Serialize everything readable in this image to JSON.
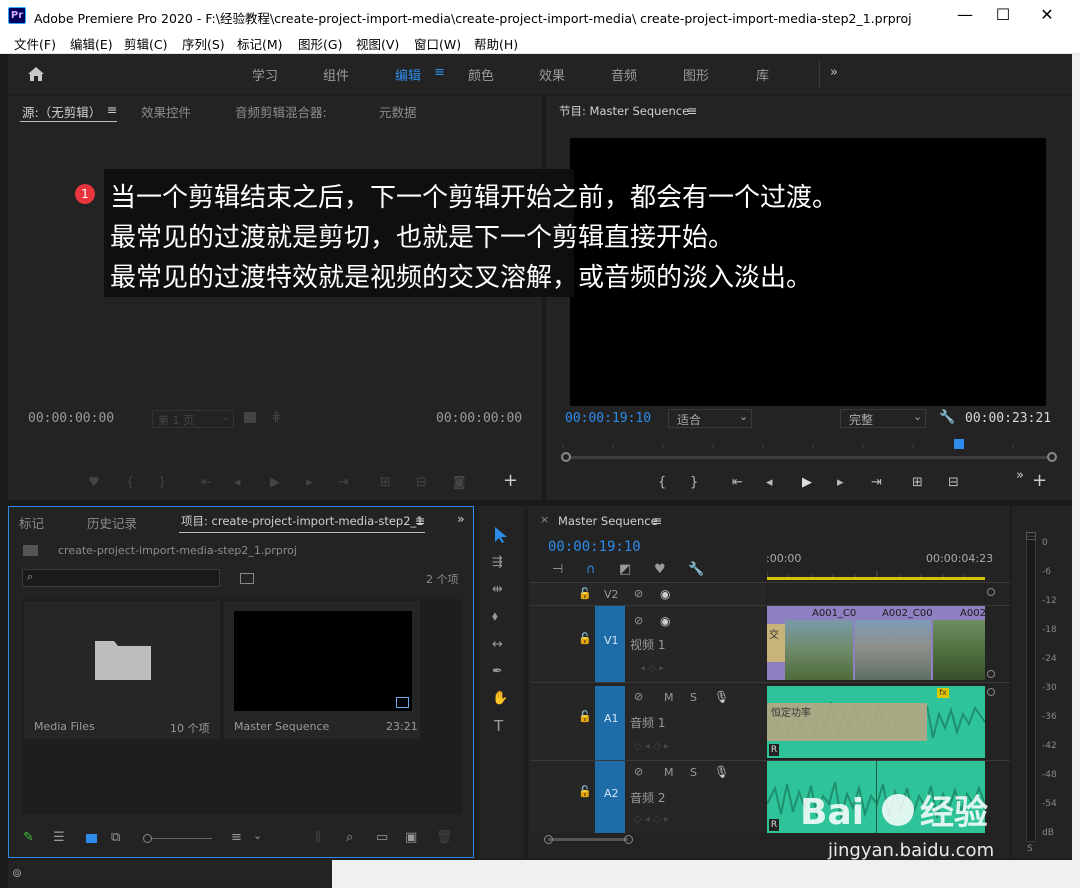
{
  "window": {
    "app_icon": "Pr",
    "title": "Adobe Premiere Pro 2020 - F:\\经验教程\\create-project-import-media\\create-project-import-media\\ create-project-import-media-step2_1.prproj",
    "minimize": "—",
    "maximize": "☐",
    "close": "✕"
  },
  "menu": [
    "文件(F)",
    "编辑(E)",
    "剪辑(C)",
    "序列(S)",
    "标记(M)",
    "图形(G)",
    "视图(V)",
    "窗口(W)",
    "帮助(H)"
  ],
  "workspaces": {
    "home_icon": "home-icon",
    "items": [
      "学习",
      "组件",
      "编辑",
      "颜色",
      "效果",
      "音频",
      "图形",
      "库"
    ],
    "active": "编辑",
    "more": "»",
    "menu_glyph": "≡"
  },
  "source_panel": {
    "tabs": [
      "源:（无剪辑）",
      "效果控件",
      "音频剪辑混合器:",
      "元数据"
    ],
    "tab_menu": "≡",
    "timecode_left": "00:00:00:00",
    "timecode_right": "00:00:00:00",
    "page_select": "第 1 页"
  },
  "program_panel": {
    "title": "节目: Master Sequence",
    "title_menu": "≡",
    "timecode_left": "00:00:19:10",
    "fit_select": "适合",
    "quality_select": "完整",
    "timecode_right": "00:00:23:21"
  },
  "annotation": {
    "badge": "1",
    "lines": [
      "当一个剪辑结束之后，下一个剪辑开始之前，都会有一个过渡。",
      "最常见的过渡就是剪切，也就是下一个剪辑直接开始。",
      "最常见的过渡特效就是视频的交叉溶解，或音频的淡入淡出。"
    ]
  },
  "project_panel": {
    "tabs": [
      "标记",
      "历史记录",
      "项目: create-project-import-media-step2_1"
    ],
    "tab_menu": "≡",
    "more": "»",
    "project_file": "create-project-import-media-step2_1.prproj",
    "item_count": "2 个项",
    "search_placeholder": "",
    "bins": [
      {
        "name": "Media Files",
        "info": "10 个项"
      },
      {
        "name": "Master Sequence",
        "info": "23:21"
      }
    ]
  },
  "timeline_panel": {
    "close": "×",
    "title": "Master Sequence",
    "title_menu": "≡",
    "timecode": "00:00:19:10",
    "ruler_start": ":00:00",
    "ruler_end": "00:00:04:23",
    "tracks": [
      {
        "id": "V2",
        "name": ""
      },
      {
        "id": "V1",
        "name": "视频 1"
      },
      {
        "id": "A1",
        "name": "音频 1"
      },
      {
        "id": "A2",
        "name": "音频 2"
      }
    ],
    "clips_v1": [
      "交",
      "A001_C0",
      "A002_C00",
      "A002"
    ],
    "audio_transition": "恒定功率",
    "fx_badge": "fx",
    "r_badge": "R",
    "m_label": "M",
    "s_label": "S"
  },
  "audio_meter": {
    "labels": [
      "0",
      "-6",
      "-12",
      "-18",
      "-24",
      "-30",
      "-36",
      "-42",
      "-48",
      "-54",
      "dB"
    ],
    "solo": "S"
  },
  "watermark": {
    "url": "jingyan.baidu.com"
  },
  "colors": {
    "accent_blue": "#2d8ceb",
    "panel_bg": "#232323",
    "video_clip": "#8f80c2",
    "audio_clip": "#2fc39a",
    "playhead": "#2d8ceb",
    "badge_red": "#e8343c"
  }
}
